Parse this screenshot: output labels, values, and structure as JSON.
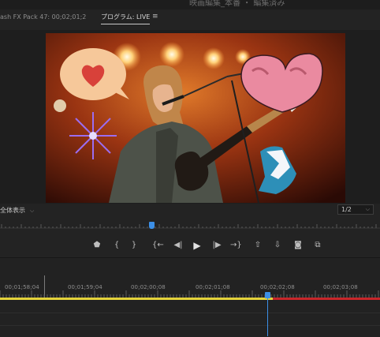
{
  "window": {
    "title": "映画編集_本番 ・ 編集済み"
  },
  "tabs": {
    "source": "ash FX Pack 47: 00;02;01;2",
    "program": "プログラム: LIVE",
    "menu_icon": "≡"
  },
  "monitor": {
    "zoom_label": "全体表示",
    "zoom_chevron": "⌵",
    "resolution_label": "1/2",
    "resolution_chevron": "⌵"
  },
  "transport": {
    "buttons": [
      {
        "name": "add-marker-button",
        "glyph": "⬟"
      },
      {
        "name": "mark-in-button",
        "glyph": "{"
      },
      {
        "name": "mark-out-button",
        "glyph": "}"
      },
      {
        "name": "go-to-in-button",
        "glyph": "{←"
      },
      {
        "name": "step-back-button",
        "glyph": "◀|"
      },
      {
        "name": "play-button",
        "glyph": "▶"
      },
      {
        "name": "step-forward-button",
        "glyph": "|▶"
      },
      {
        "name": "go-to-out-button",
        "glyph": "→}"
      },
      {
        "name": "lift-button",
        "glyph": "⇧"
      },
      {
        "name": "extract-button",
        "glyph": "⇩"
      },
      {
        "name": "export-frame-button",
        "glyph": "◙"
      },
      {
        "name": "comparison-view-button",
        "glyph": "⧉"
      }
    ]
  },
  "timeline": {
    "timecodes": [
      "00;01;58;04",
      "00;01;59;04",
      "00;02;00;08",
      "00;02;01;08",
      "00;02;02;08",
      "00;02;03;08"
    ]
  },
  "colors": {
    "accent": "#3c8fe6",
    "work_area": "#e3d23a",
    "render_red": "#c8262a"
  }
}
